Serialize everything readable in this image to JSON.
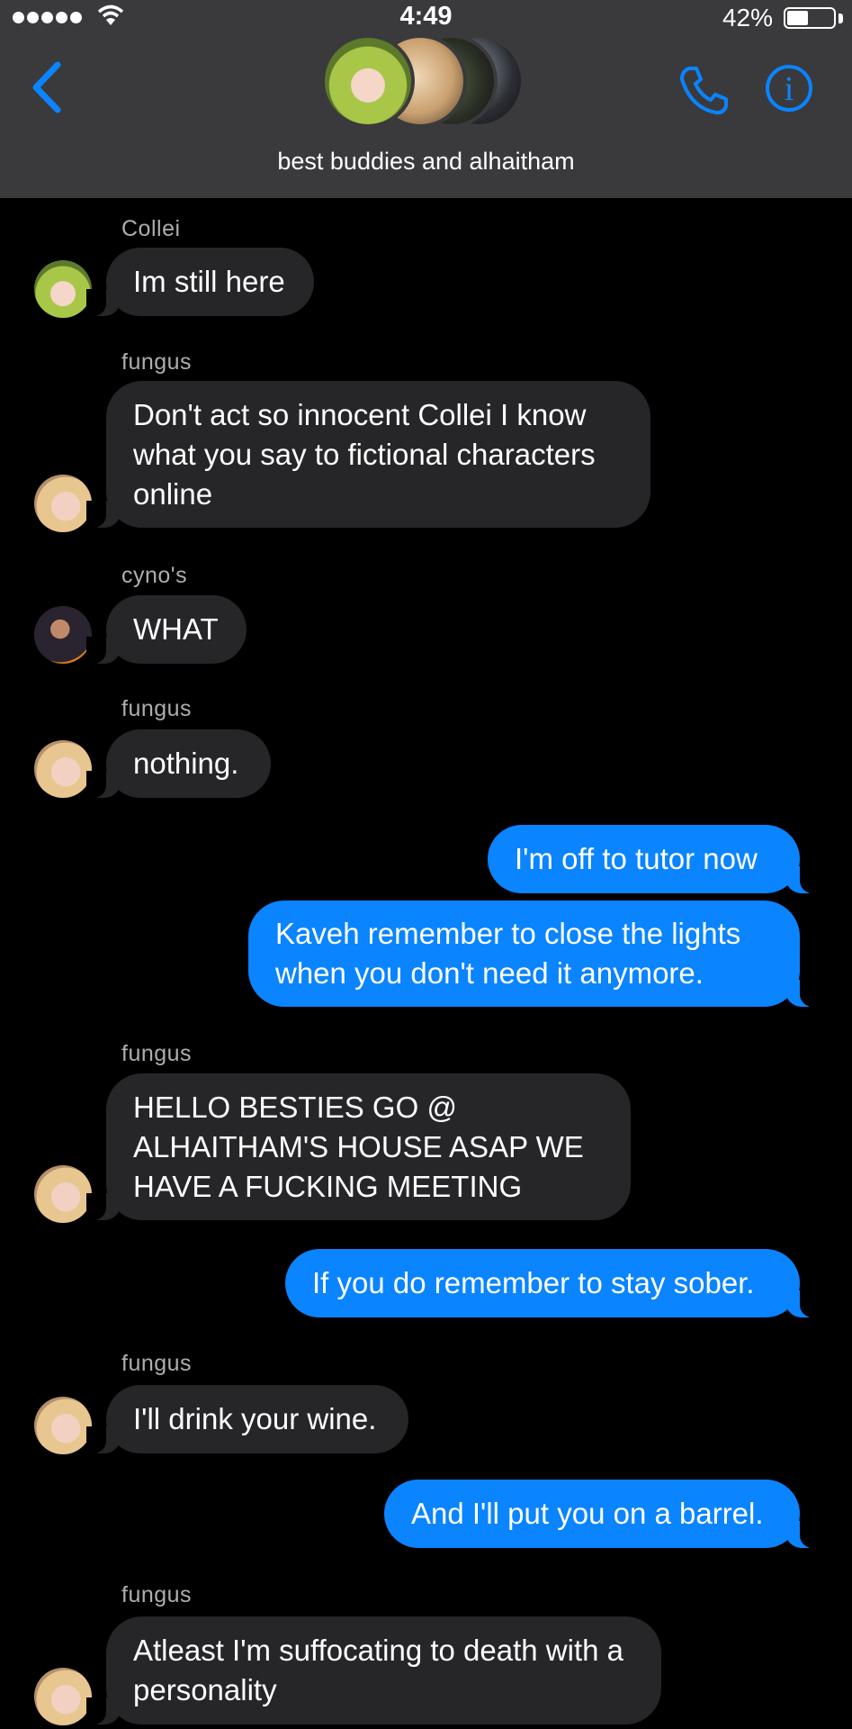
{
  "status_bar": {
    "time": "4:49",
    "battery": "42%",
    "battery_level": 0.42
  },
  "header": {
    "group_name": "best buddies and alhaitham",
    "accent_color": "#0a84ff",
    "icons": [
      "back-chevron-icon",
      "phone-icon",
      "info-icon"
    ]
  },
  "messages": [
    {
      "sender": "Collei",
      "text": "Im still here",
      "from_me": false
    },
    {
      "sender": "fungus",
      "text": "Don't act so innocent Collei I know what you say to fictional characters online",
      "from_me": false
    },
    {
      "sender": "cyno's",
      "text": "WHAT",
      "from_me": false
    },
    {
      "sender": "fungus",
      "text": "nothing.",
      "from_me": false
    },
    {
      "text": "I'm off to tutor now",
      "from_me": true
    },
    {
      "text": "Kaveh remember to close the lights when you don't need it anymore.",
      "from_me": true
    },
    {
      "sender": "fungus",
      "text": "HELLO BESTIES GO @ ALHAITHAM'S HOUSE ASAP WE HAVE A FUCKING MEETING",
      "from_me": false
    },
    {
      "text": "If you do remember to stay sober.",
      "from_me": true
    },
    {
      "sender": "fungus",
      "text": "I'll drink your wine.",
      "from_me": false
    },
    {
      "text": "And I'll put you on a barrel.",
      "from_me": true
    },
    {
      "sender": "fungus",
      "text": "Atleast I'm suffocating to death with a personality",
      "from_me": false
    }
  ]
}
